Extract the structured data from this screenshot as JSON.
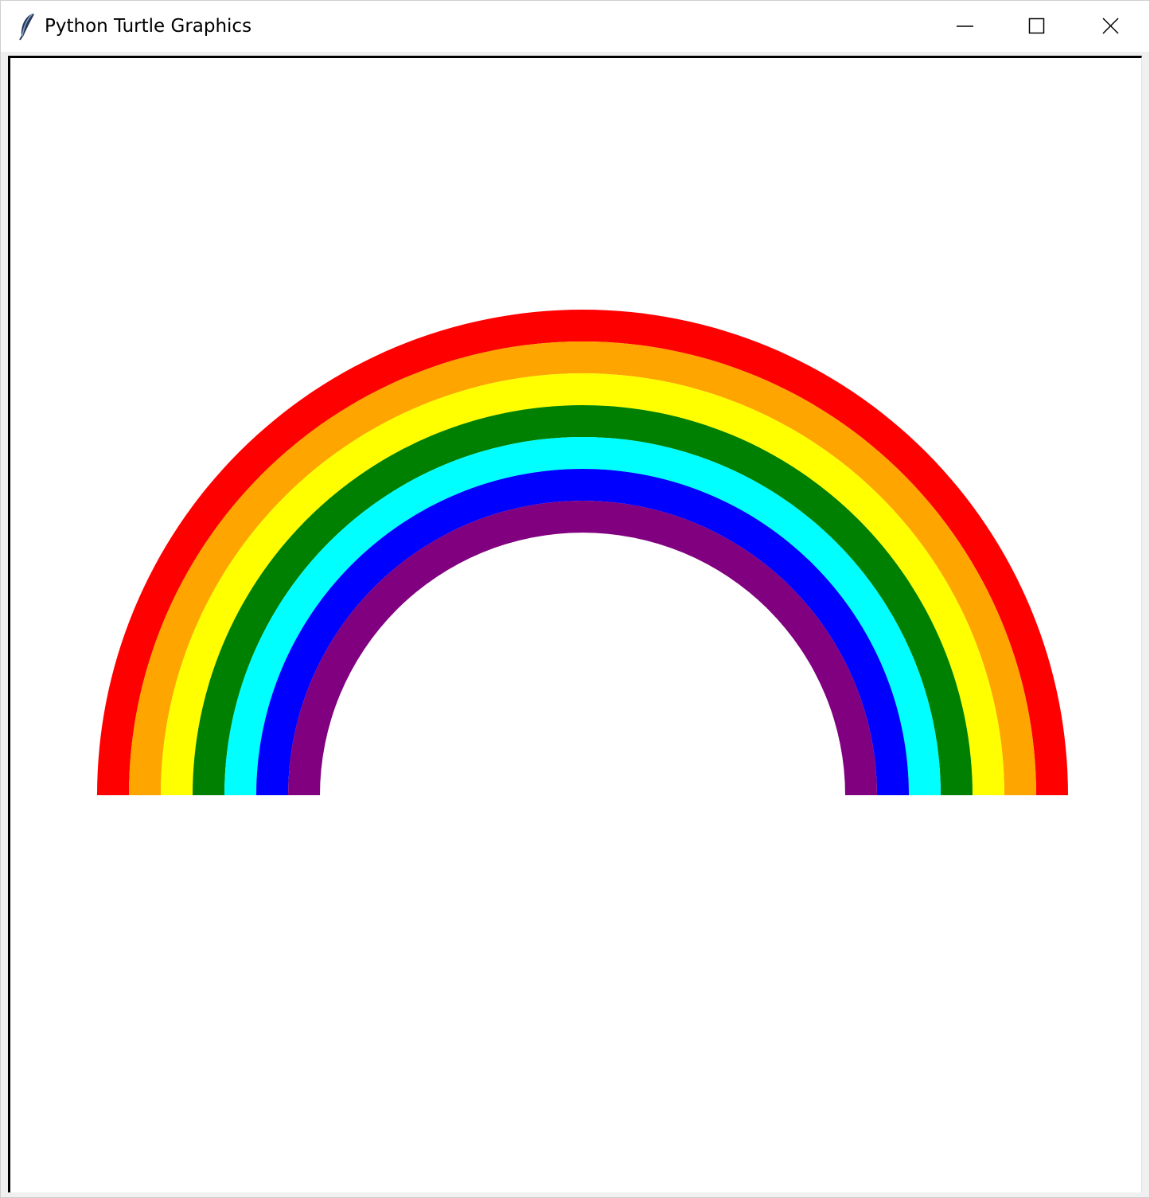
{
  "window": {
    "title": "Python Turtle Graphics",
    "icon": "feather-icon",
    "controls": {
      "minimize_icon": "minimize-icon",
      "maximize_icon": "maximize-icon",
      "close_icon": "close-icon"
    }
  },
  "canvas": {
    "background": "#ffffff",
    "rainbow_bands": [
      {
        "name": "red",
        "color": "#ff0000"
      },
      {
        "name": "orange",
        "color": "#ffa500"
      },
      {
        "name": "yellow",
        "color": "#ffff00"
      },
      {
        "name": "green",
        "color": "#008000"
      },
      {
        "name": "cyan",
        "color": "#00ffff"
      },
      {
        "name": "blue",
        "color": "#0000ff"
      },
      {
        "name": "purple",
        "color": "#800080"
      }
    ]
  }
}
